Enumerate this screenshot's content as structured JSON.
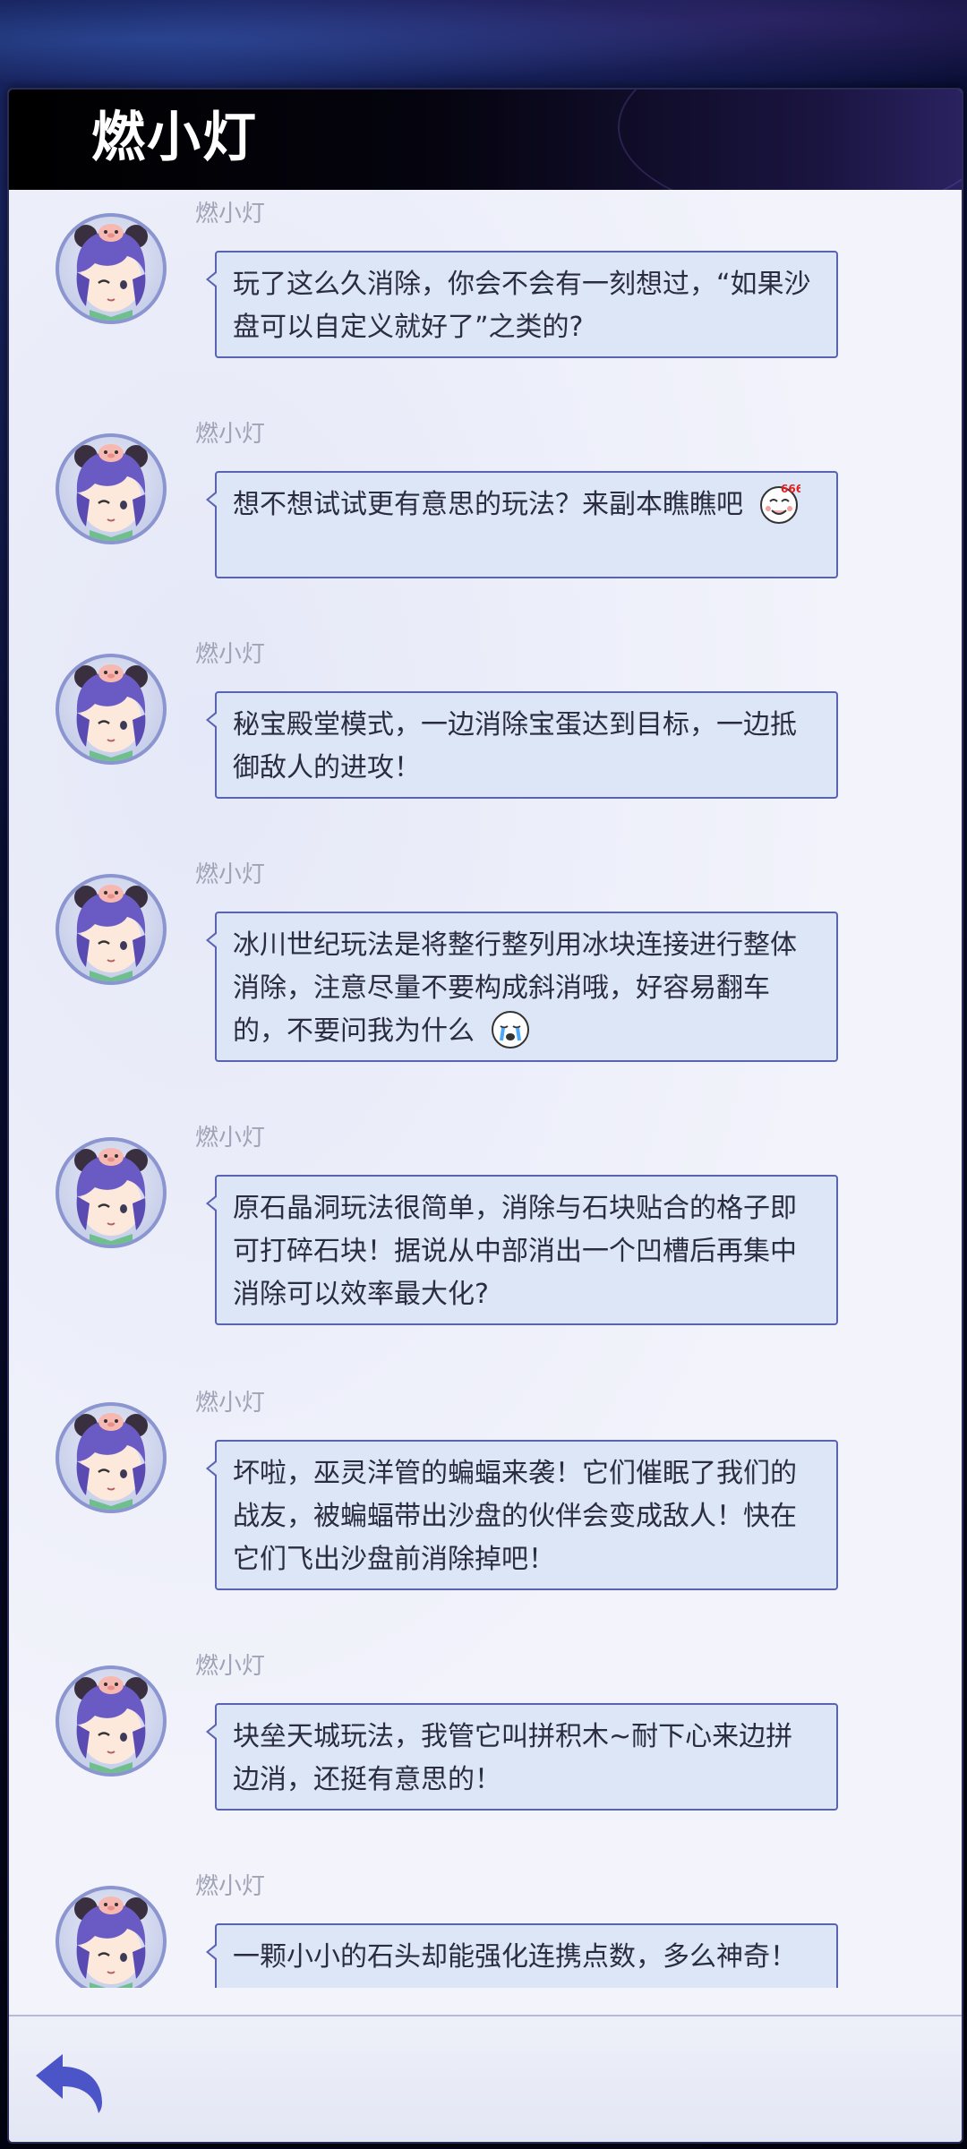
{
  "header": {
    "title": "燃小灯"
  },
  "messages": [
    {
      "sender": "燃小灯",
      "text": "玩了这么久消除，你会不会有一刻想过，“如果沙盘可以自定义就好了”之类的?",
      "emoji": ""
    },
    {
      "sender": "燃小灯",
      "text": "想不想试试更有意思的玩法？来副本瞧瞧吧",
      "emoji": "666-face"
    },
    {
      "sender": "燃小灯",
      "text": "秘宝殿堂模式，一边消除宝蛋达到目标，一边抵御敌人的进攻！",
      "emoji": ""
    },
    {
      "sender": "燃小灯",
      "text": "冰川世纪玩法是将整行整列用冰块连接进行整体消除，注意尽量不要构成斜消哦，好容易翻车的，不要问我为什么",
      "emoji": "crying-face"
    },
    {
      "sender": "燃小灯",
      "text": "原石晶洞玩法很简单，消除与石块贴合的格子即可打碎石块！据说从中部消出一个凹槽后再集中消除可以效率最大化?",
      "emoji": ""
    },
    {
      "sender": "燃小灯",
      "text": "坏啦，巫灵洋管的蝙蝠来袭！它们催眠了我们的战友，被蝙蝠带出沙盘的伙伴会变成敌人！快在它们飞出沙盘前消除掉吧！",
      "emoji": ""
    },
    {
      "sender": "燃小灯",
      "text": "块垒天城玩法，我管它叫拼积木~耐下心来边拼边消，还挺有意思的！",
      "emoji": ""
    },
    {
      "sender": "燃小灯",
      "text": "一颗小小的石头却能强化连携点数，多么神奇！",
      "emoji": ""
    }
  ],
  "emoji_labels": {
    "666-face": "666"
  },
  "footer": {
    "back_icon": "back-arrow-icon"
  },
  "colors": {
    "bubble_bg": "#dde6f6",
    "bubble_border": "#5a63b2",
    "back_arrow": "#4c55c8",
    "sender_text": "#a0a3b6"
  }
}
